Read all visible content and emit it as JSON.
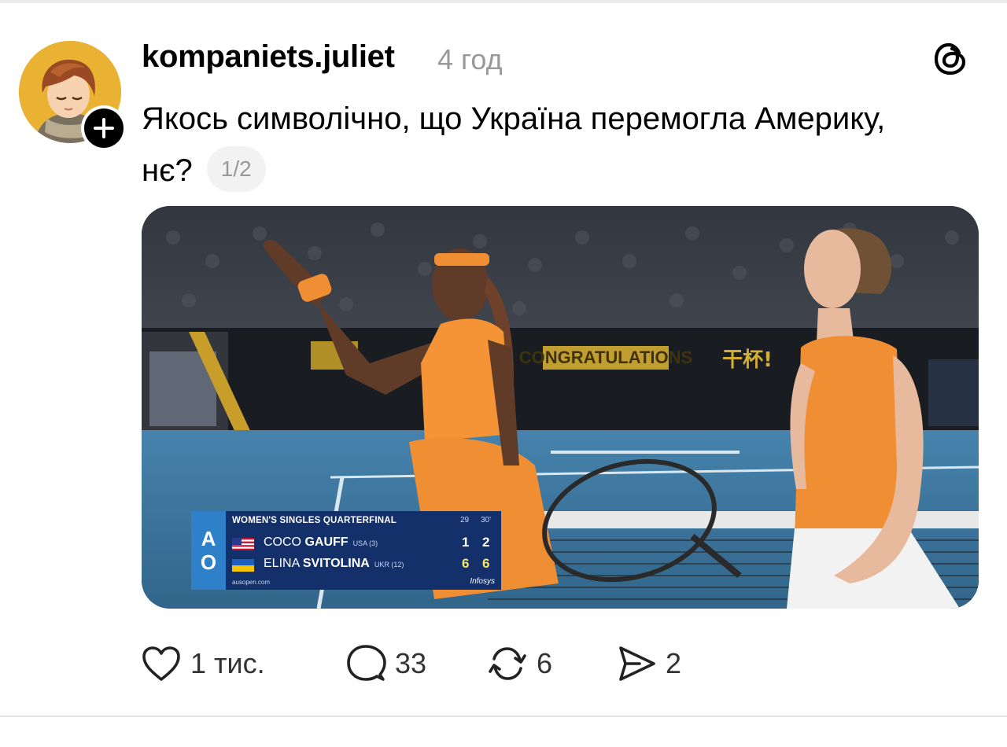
{
  "post": {
    "username": "kompaniets.juliet",
    "time": "4 год",
    "text": "Якось символічно, що Україна перемогла Америку, нє?",
    "page_indicator": "1/2"
  },
  "media": {
    "scorebug": {
      "logo_letters": [
        "A",
        "O"
      ],
      "round": "WOMEN'S SINGLES QUARTERFINAL",
      "set_headers": [
        "29",
        "30'"
      ],
      "players": [
        {
          "first": "COCO",
          "last": "GAUFF",
          "seed": "USA (3)",
          "sets": [
            "1",
            "2"
          ]
        },
        {
          "first": "ELINA",
          "last": "SVITOLINA",
          "seed": "UKR (12)",
          "sets": [
            "6",
            "6"
          ]
        }
      ],
      "site": "ausopen.com",
      "sponsor": "Infosys"
    },
    "arena_banner": "CONGRATULATIONS",
    "arena_banner_cn": "干杯!"
  },
  "actions": {
    "likes": "1 тис.",
    "comments": "33",
    "reposts": "6",
    "shares": "2"
  },
  "colors": {
    "muted": "#999999",
    "pill_bg": "#f2f2f2",
    "score_blue": "#14306b",
    "ao_blue": "#2e80c8",
    "dress_orange": "#f0872e"
  }
}
